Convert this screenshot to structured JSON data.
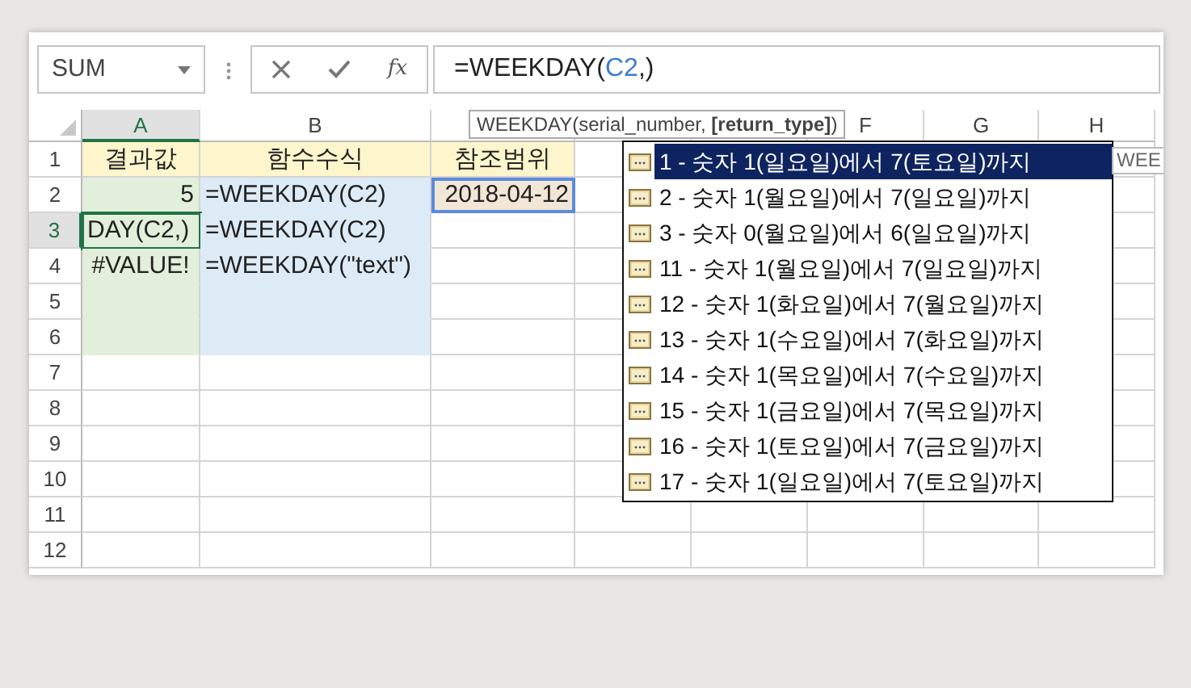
{
  "name_box": {
    "value": "SUM"
  },
  "function_button": {
    "label": "fx"
  },
  "formula": [
    {
      "text": "=WEEKDAY(",
      "kind": "plain"
    },
    {
      "text": "C2",
      "kind": "reference"
    },
    {
      "text": ",)",
      "kind": "plain"
    }
  ],
  "hint": "WEEKDAY(serial_number, **[return_type]**)",
  "columns": [
    {
      "label": "A",
      "selected": true
    },
    {
      "label": "B",
      "selected": false
    },
    {
      "selected": false
    },
    {
      "selected": false
    },
    {
      "selected": false
    },
    {
      "label": "F",
      "selected": false
    },
    {
      "label": "G",
      "selected": false
    },
    {
      "label": "H",
      "selected": false
    }
  ],
  "rows": [
    {
      "label": "1",
      "selected": false,
      "cells": [
        {
          "text": "결과값",
          "kind": "heading",
          "selected": false,
          "referenced": false
        },
        {
          "text": "함수수식",
          "kind": "heading",
          "selected": false,
          "referenced": false
        },
        {
          "text": "참조범위",
          "kind": "heading",
          "selected": false,
          "referenced": false
        }
      ]
    },
    {
      "label": "2",
      "selected": false,
      "cells": [
        {
          "text": "5",
          "kind": "number",
          "selected": false,
          "referenced": false
        },
        {
          "text": "=WEEKDAY(C2)",
          "kind": "formula",
          "selected": false,
          "referenced": false
        },
        {
          "text": "2018-04-12",
          "kind": "date",
          "selected": false,
          "referenced": true
        }
      ]
    },
    {
      "label": "3",
      "selected": true,
      "cells": [
        {
          "text": "DAY(C2,)",
          "kind": "editing",
          "selected": true,
          "referenced": false
        },
        {
          "text": "=WEEKDAY(C2)",
          "kind": "formula",
          "selected": false,
          "referenced": false
        }
      ]
    },
    {
      "label": "4",
      "selected": false,
      "cells": [
        {
          "text": "#VALUE!",
          "kind": "error",
          "selected": false,
          "referenced": false
        },
        {
          "text": "=WEEKDAY(\"text\")",
          "kind": "formula",
          "selected": false,
          "referenced": false
        }
      ]
    },
    {
      "label": "5",
      "selected": false,
      "cells": [
        {
          "kind": "result",
          "selected": false,
          "referenced": false
        },
        {
          "kind": "formula",
          "selected": false,
          "referenced": false
        }
      ]
    },
    {
      "label": "6",
      "selected": false,
      "cells": [
        {
          "kind": "result",
          "selected": false,
          "referenced": false
        },
        {
          "kind": "formula",
          "selected": false,
          "referenced": false
        }
      ]
    },
    {
      "label": "7",
      "selected": false
    },
    {
      "label": "8",
      "selected": false
    },
    {
      "label": "9",
      "selected": false
    },
    {
      "label": "10",
      "selected": false
    },
    {
      "label": "11",
      "selected": false
    },
    {
      "label": "12",
      "selected": false
    }
  ],
  "autocomplete": [
    {
      "text": "1 - 숫자 1(일요일)에서 7(토요일)까지",
      "selected": true
    },
    {
      "text": "2 - 숫자 1(월요일)에서 7(일요일)까지",
      "selected": false
    },
    {
      "text": "3 - 숫자 0(월요일)에서 6(일요일)까지",
      "selected": false
    },
    {
      "text": "11 - 숫자 1(월요일)에서 7(일요일)까지",
      "selected": false
    },
    {
      "text": "12 - 숫자 1(화요일)에서 7(월요일)까지",
      "selected": false
    },
    {
      "text": "13 - 숫자 1(수요일)에서 7(화요일)까지",
      "selected": false
    },
    {
      "text": "14 - 숫자 1(목요일)에서 7(수요일)까지",
      "selected": false
    },
    {
      "text": "15 - 숫자 1(금요일)에서 7(목요일)까지",
      "selected": false
    },
    {
      "text": "16 - 숫자 1(토요일)에서 7(금요일)까지",
      "selected": false
    },
    {
      "text": "17 - 숫자 1(일요일)에서 7(토요일)까지",
      "selected": false
    }
  ],
  "side_tip": "WEE"
}
